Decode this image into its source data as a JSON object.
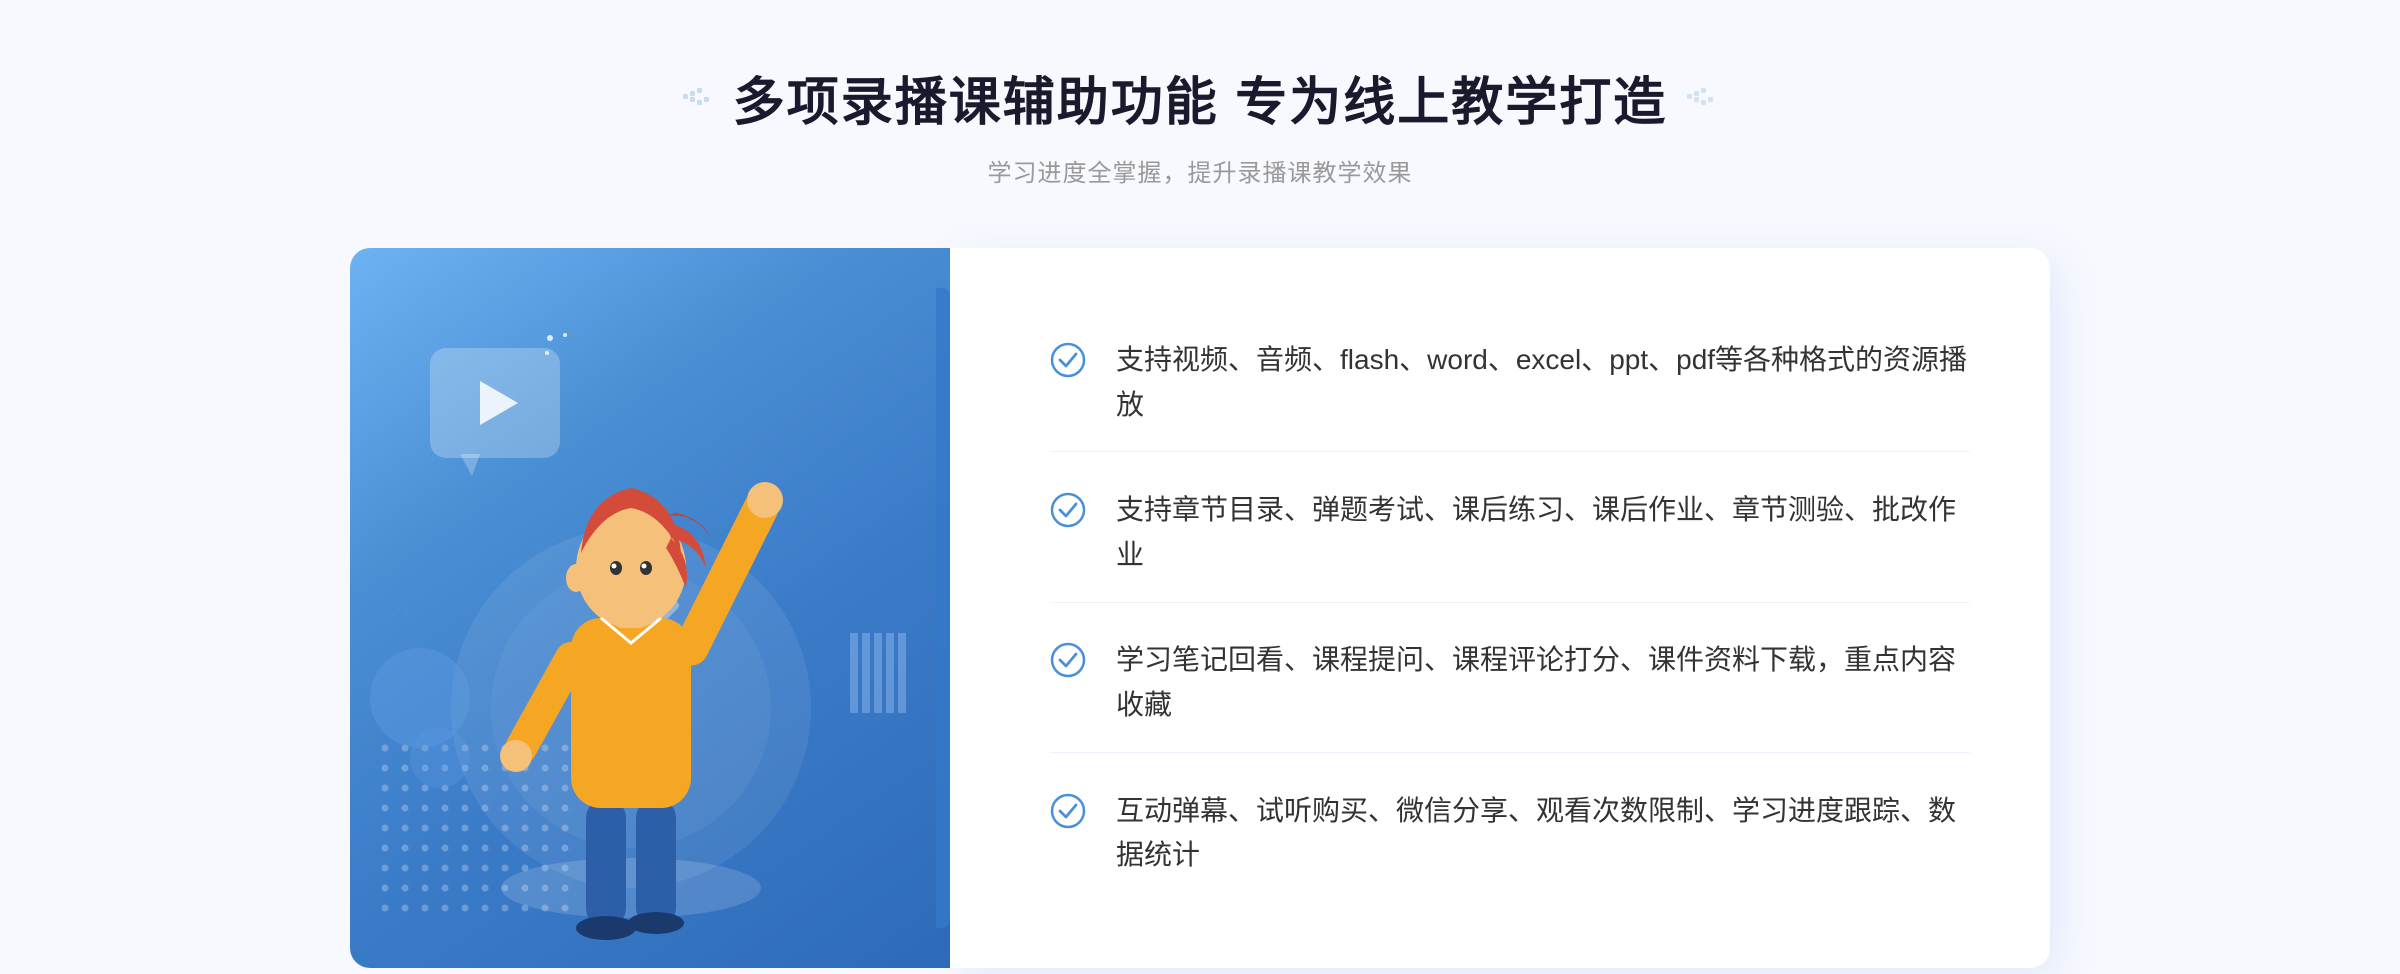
{
  "header": {
    "title": "多项录播课辅助功能 专为线上教学打造",
    "subtitle": "学习进度全掌握，提升录播课教学效果"
  },
  "features": [
    {
      "id": "feature-1",
      "text": "支持视频、音频、flash、word、excel、ppt、pdf等各种格式的资源播放"
    },
    {
      "id": "feature-2",
      "text": "支持章节目录、弹题考试、课后练习、课后作业、章节测验、批改作业"
    },
    {
      "id": "feature-3",
      "text": "学习笔记回看、课程提问、课程评论打分、课件资料下载，重点内容收藏"
    },
    {
      "id": "feature-4",
      "text": "互动弹幕、试听购买、微信分享、观看次数限制、学习进度跟踪、数据统计"
    }
  ],
  "decorations": {
    "leftArrow": "»",
    "checkIconColor": "#4a90d9",
    "titleDecoColor": "#4a90d9"
  }
}
